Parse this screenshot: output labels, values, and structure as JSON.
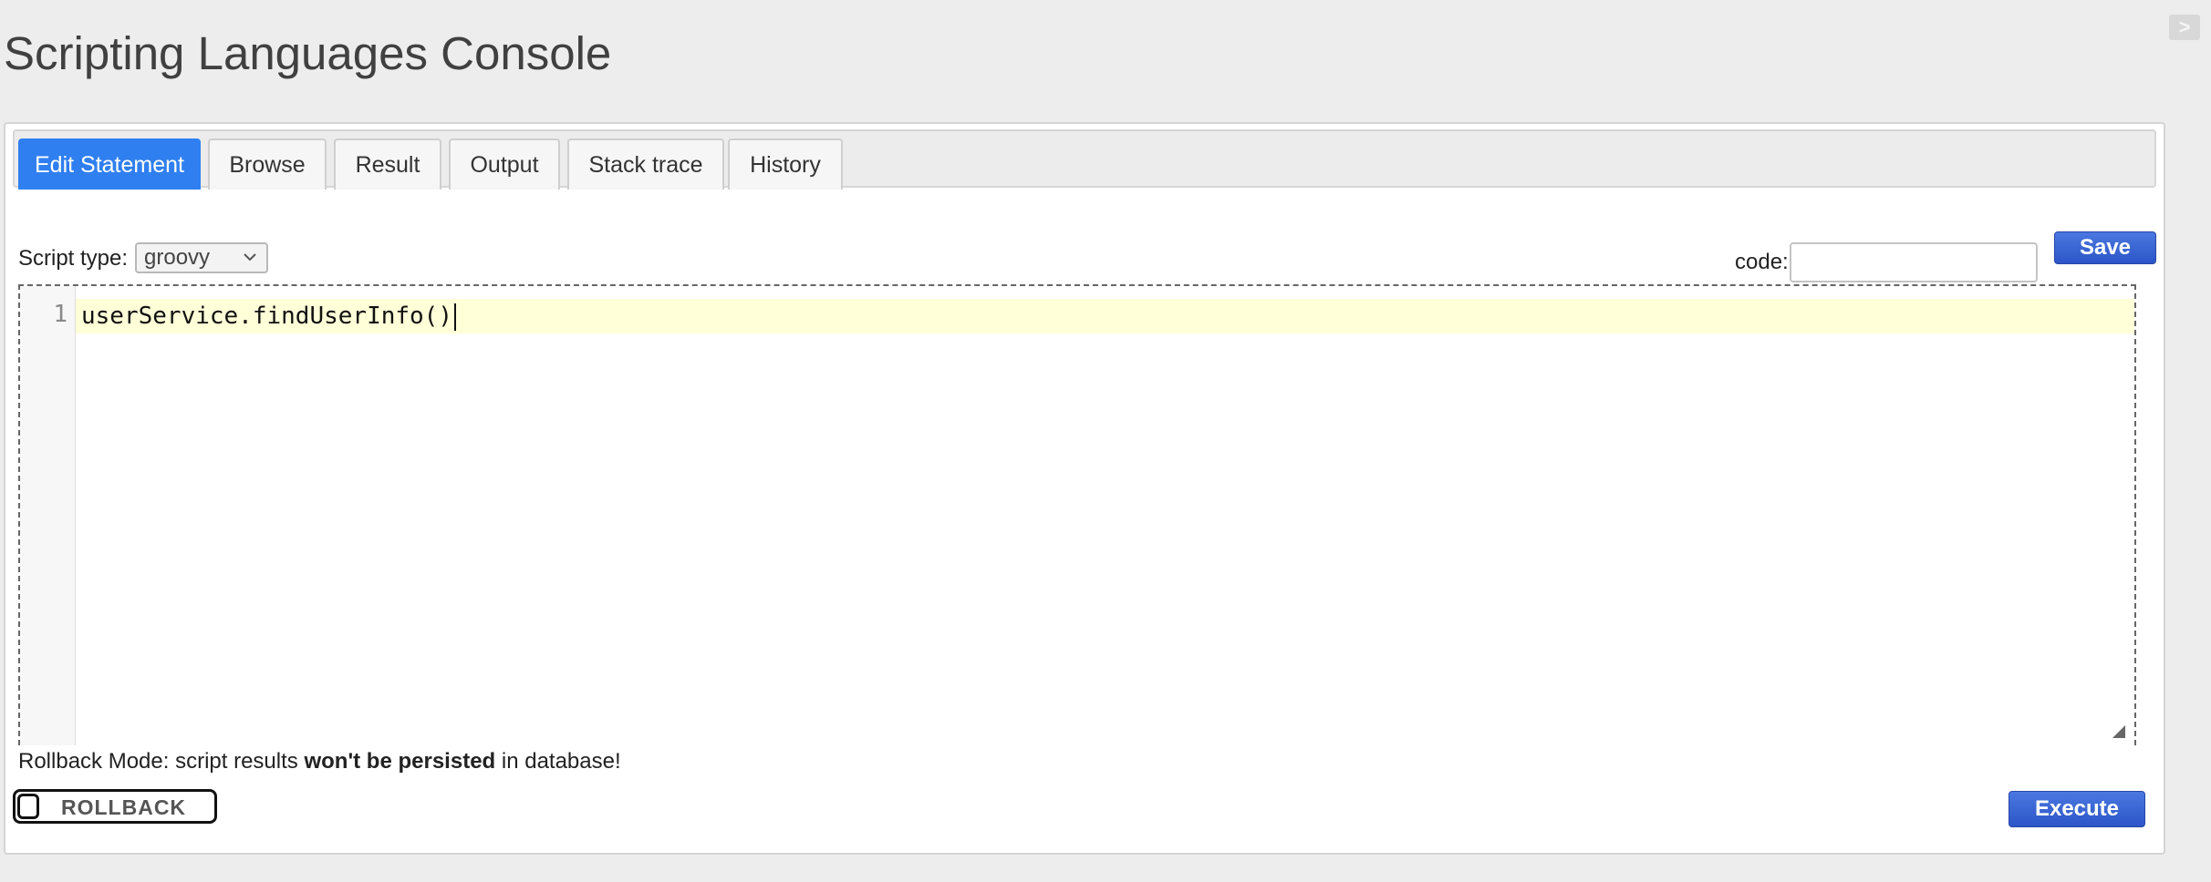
{
  "page": {
    "title": "Scripting Languages Console",
    "collapse_toggle": ">"
  },
  "tabs": [
    {
      "label": "Edit Statement",
      "active": true
    },
    {
      "label": "Browse",
      "active": false
    },
    {
      "label": "Result",
      "active": false
    },
    {
      "label": "Output",
      "active": false
    },
    {
      "label": "Stack trace",
      "active": false
    },
    {
      "label": "History",
      "active": false
    }
  ],
  "script_type": {
    "label": "Script type:",
    "value": "groovy"
  },
  "code_field": {
    "label": "code:",
    "value": "",
    "placeholder": ""
  },
  "buttons": {
    "save": "Save",
    "execute": "Execute"
  },
  "editor": {
    "line_number": "1",
    "code": "userService.findUserInfo()"
  },
  "rollback": {
    "prefix": "Rollback Mode: script results ",
    "emphasis": "won't be persisted",
    "suffix": " in database!",
    "toggle_label": "ROLLBACK"
  },
  "icons": {
    "collapse": "chevron-right-icon",
    "select": "chevron-down-icon",
    "resize": "resize-handle-icon"
  },
  "colors": {
    "active_tab": "#2f7ff0",
    "button_blue": "#2c55c8",
    "current_line": "#ffffd8",
    "background": "#ededed"
  }
}
